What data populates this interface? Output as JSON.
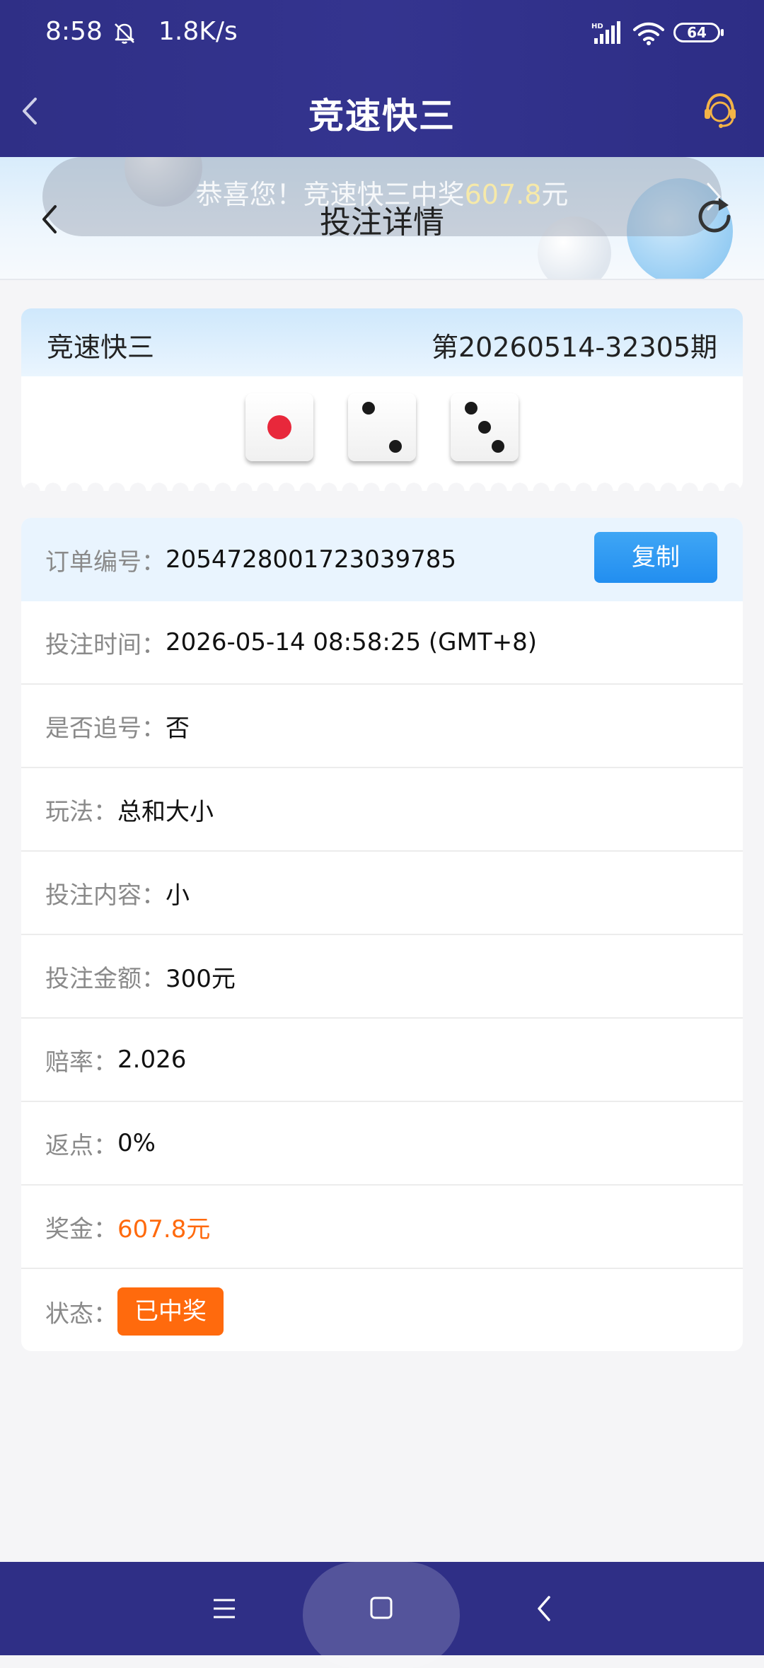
{
  "status_bar": {
    "time": "8:58",
    "speed": "1.8K/s",
    "battery": "64",
    "icons": [
      "bell-muted-icon",
      "hd-signal-icon",
      "wifi-icon",
      "battery-icon"
    ]
  },
  "header": {
    "title": "竞速快三",
    "icons": [
      "back-arrow-icon",
      "customer-service-icon"
    ]
  },
  "sub_header": {
    "title": "投注详情",
    "marquee_prefix": "恭喜您！竞速快三中奖",
    "marquee_amount": "607.8",
    "marquee_suffix": "元",
    "icons": [
      "back-chevron-icon",
      "refresh-icon",
      "chevron-right-icon"
    ]
  },
  "result": {
    "game_name": "竞速快三",
    "issue": "第20260514-32305期",
    "dice": [
      1,
      2,
      3
    ]
  },
  "details": {
    "order_label": "订单编号：",
    "order_value": "2054728001723039785",
    "copy_label": "复制",
    "time_label": "投注时间：",
    "time_value": "2026-05-14 08:58:25 (GMT+8)",
    "chase_label": "是否追号：",
    "chase_value": "否",
    "play_label": "玩法：",
    "play_value": "总和大小",
    "content_label": "投注内容：",
    "content_value": "小",
    "amount_label": "投注金额：",
    "amount_value": "300元",
    "odds_label": "赔率：",
    "odds_value": "2.026",
    "rebate_label": "返点：",
    "rebate_value": "0%",
    "prize_label": "奖金：",
    "prize_value": "607.8元",
    "status_label": "状态：",
    "status_value": "已中奖"
  },
  "colors": {
    "header_bg": "#2f2f86",
    "accent_blue": "#228ef0",
    "accent_orange": "#ff6a0d",
    "die_red": "#e8283b"
  }
}
